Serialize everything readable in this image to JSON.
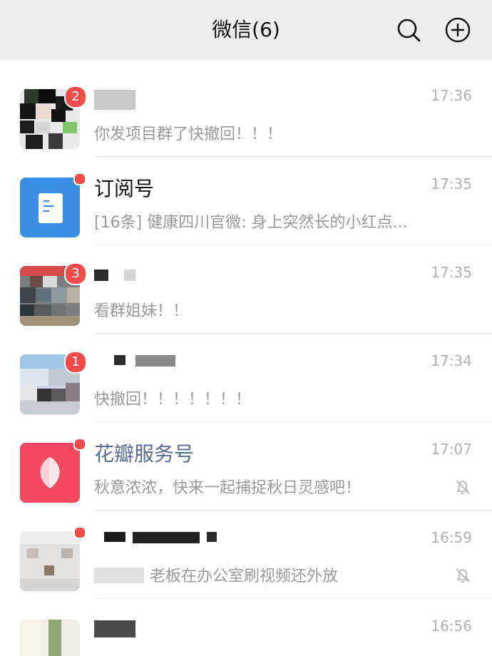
{
  "header": {
    "title": "微信(6)",
    "search_icon": "search-icon",
    "add_icon": "plus-circle-icon"
  },
  "chats": [
    {
      "name": "",
      "preview": "你发项目群了快撤回！！！",
      "time": "17:36",
      "badge": "2",
      "muted": false
    },
    {
      "name": "订阅号",
      "preview": "[16条] 健康四川官微: 身上突然长的小红点...",
      "time": "17:35",
      "dot": true,
      "muted": false
    },
    {
      "name": "",
      "preview": "看群姐妹！！",
      "time": "17:35",
      "badge": "3",
      "muted": false
    },
    {
      "name": "",
      "preview": "快撤回！！！！！！！",
      "time": "17:34",
      "badge": "1",
      "muted": false
    },
    {
      "name": "花瓣服务号",
      "preview": "秋意浓浓，快来一起捕捉秋日灵感吧！",
      "time": "17:07",
      "dot": true,
      "muted": true
    },
    {
      "name": "",
      "preview": "老板在办公室刷视频还外放",
      "time": "16:59",
      "dot": true,
      "muted": true
    },
    {
      "name": "",
      "preview": "",
      "time": "16:56",
      "muted": false
    }
  ],
  "colors": {
    "badge": "#f44a4a",
    "header_bg": "#ededed",
    "service_name": "#576b95",
    "subscription_icon_bg": "#3a8ee6",
    "huaban_icon_bg": "#f5475f"
  }
}
